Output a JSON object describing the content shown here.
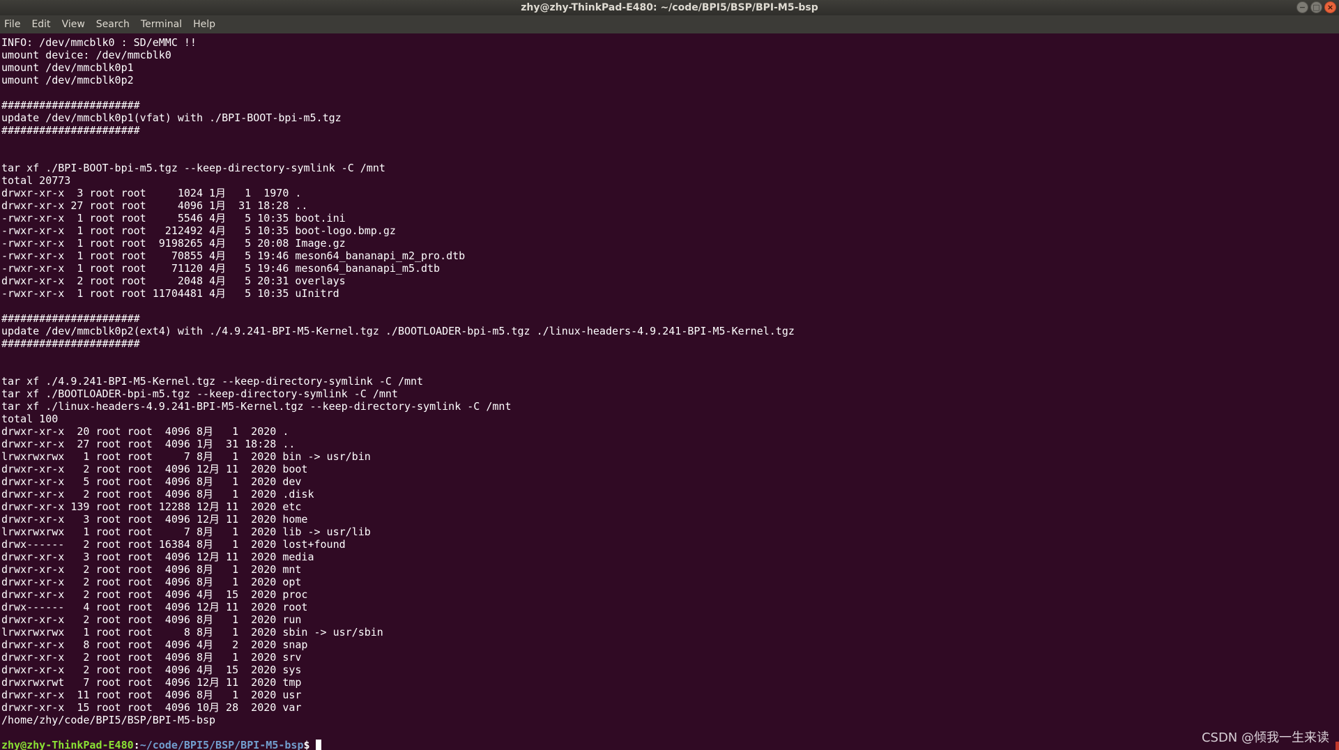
{
  "window": {
    "title": "zhy@zhy-ThinkPad-E480: ~/code/BPI5/BSP/BPI-M5-bsp",
    "minimize_glyph": "−",
    "maximize_glyph": "□",
    "close_glyph": "×"
  },
  "menu": [
    "File",
    "Edit",
    "View",
    "Search",
    "Terminal",
    "Help"
  ],
  "terminal": {
    "lines": [
      "INFO: /dev/mmcblk0 : SD/eMMC !!",
      "umount device: /dev/mmcblk0",
      "umount /dev/mmcblk0p1",
      "umount /dev/mmcblk0p2",
      "",
      "######################",
      "update /dev/mmcblk0p1(vfat) with ./BPI-BOOT-bpi-m5.tgz",
      "######################",
      "",
      "",
      "tar xf ./BPI-BOOT-bpi-m5.tgz --keep-directory-symlink -C /mnt",
      "total 20773",
      "drwxr-xr-x  3 root root     1024 1月   1  1970 .",
      "drwxr-xr-x 27 root root     4096 1月  31 18:28 ..",
      "-rwxr-xr-x  1 root root     5546 4月   5 10:35 boot.ini",
      "-rwxr-xr-x  1 root root   212492 4月   5 10:35 boot-logo.bmp.gz",
      "-rwxr-xr-x  1 root root  9198265 4月   5 20:08 Image.gz",
      "-rwxr-xr-x  1 root root    70855 4月   5 19:46 meson64_bananapi_m2_pro.dtb",
      "-rwxr-xr-x  1 root root    71120 4月   5 19:46 meson64_bananapi_m5.dtb",
      "drwxr-xr-x  2 root root     2048 4月   5 20:31 overlays",
      "-rwxr-xr-x  1 root root 11704481 4月   5 10:35 uInitrd",
      "",
      "######################",
      "update /dev/mmcblk0p2(ext4) with ./4.9.241-BPI-M5-Kernel.tgz ./BOOTLOADER-bpi-m5.tgz ./linux-headers-4.9.241-BPI-M5-Kernel.tgz",
      "######################",
      "",
      "",
      "tar xf ./4.9.241-BPI-M5-Kernel.tgz --keep-directory-symlink -C /mnt",
      "tar xf ./BOOTLOADER-bpi-m5.tgz --keep-directory-symlink -C /mnt",
      "tar xf ./linux-headers-4.9.241-BPI-M5-Kernel.tgz --keep-directory-symlink -C /mnt",
      "total 100",
      "drwxr-xr-x  20 root root  4096 8月   1  2020 .",
      "drwxr-xr-x  27 root root  4096 1月  31 18:28 ..",
      "lrwxrwxrwx   1 root root     7 8月   1  2020 bin -> usr/bin",
      "drwxr-xr-x   2 root root  4096 12月 11  2020 boot",
      "drwxr-xr-x   5 root root  4096 8月   1  2020 dev",
      "drwxr-xr-x   2 root root  4096 8月   1  2020 .disk",
      "drwxr-xr-x 139 root root 12288 12月 11  2020 etc",
      "drwxr-xr-x   3 root root  4096 12月 11  2020 home",
      "lrwxrwxrwx   1 root root     7 8月   1  2020 lib -> usr/lib",
      "drwx------   2 root root 16384 8月   1  2020 lost+found",
      "drwxr-xr-x   3 root root  4096 12月 11  2020 media",
      "drwxr-xr-x   2 root root  4096 8月   1  2020 mnt",
      "drwxr-xr-x   2 root root  4096 8月   1  2020 opt",
      "drwxr-xr-x   2 root root  4096 4月  15  2020 proc",
      "drwx------   4 root root  4096 12月 11  2020 root",
      "drwxr-xr-x   2 root root  4096 8月   1  2020 run",
      "lrwxrwxrwx   1 root root     8 8月   1  2020 sbin -> usr/sbin",
      "drwxr-xr-x   8 root root  4096 4月   2  2020 snap",
      "drwxr-xr-x   2 root root  4096 8月   1  2020 srv",
      "drwxr-xr-x   2 root root  4096 4月  15  2020 sys",
      "drwxrwxrwt   7 root root  4096 12月 11  2020 tmp",
      "drwxr-xr-x  11 root root  4096 8月   1  2020 usr",
      "drwxr-xr-x  15 root root  4096 10月 28  2020 var",
      "/home/zhy/code/BPI5/BSP/BPI-M5-bsp",
      ""
    ],
    "prompt": {
      "user_host": "zhy@zhy-ThinkPad-E480",
      "separator": ":",
      "path": "~/code/BPI5/BSP/BPI-M5-bsp",
      "symbol": "$"
    }
  },
  "watermark": "CSDN @倾我一生来读",
  "colors": {
    "background": "#300a24",
    "text": "#ffffff",
    "prompt_user": "#8ae234",
    "prompt_path": "#729fcf"
  }
}
